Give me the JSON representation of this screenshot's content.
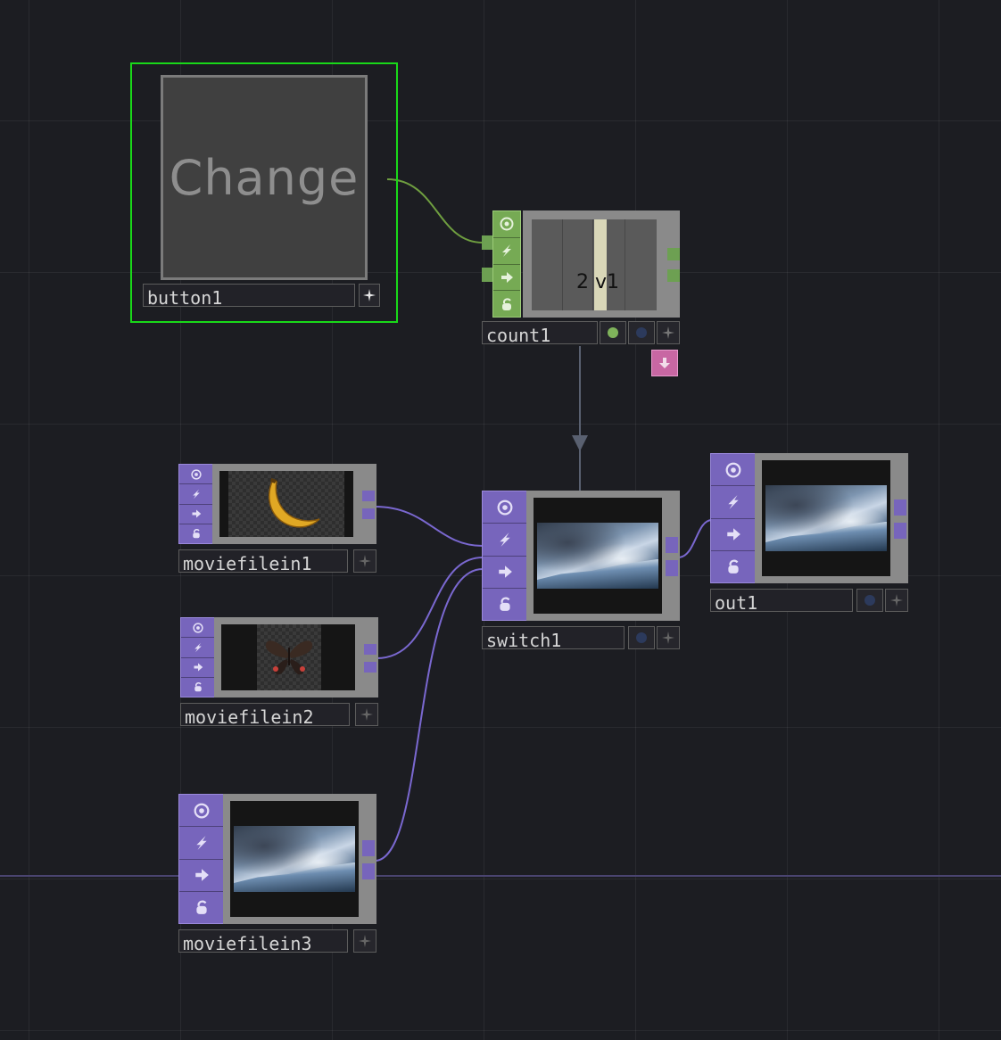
{
  "nodes": {
    "button1": {
      "name": "button1",
      "label": "Change"
    },
    "count1": {
      "name": "count1",
      "value_text": "2 v1"
    },
    "switch1": {
      "name": "switch1"
    },
    "out1": {
      "name": "out1"
    },
    "moviefilein1": {
      "name": "moviefilein1"
    },
    "moviefilein2": {
      "name": "moviefilein2"
    },
    "moviefilein3": {
      "name": "moviefilein3"
    }
  },
  "colors": {
    "background": "#1c1d22",
    "top_purple": "#7765bc",
    "chop_green": "#7fb35b",
    "selected_outline": "#19d819",
    "top_wire": "#7a68d0",
    "chop_wire": "#6f9e40",
    "export_pink": "#c867a3"
  },
  "icons": {
    "viewer_flag": "target-icon",
    "bypass_flag": "lightning-icon",
    "display_flag": "arrow-right-icon",
    "lock_flag": "lock-icon",
    "viewer_toggle": "plus-star-icon",
    "export_flag": "arrow-down-icon"
  }
}
